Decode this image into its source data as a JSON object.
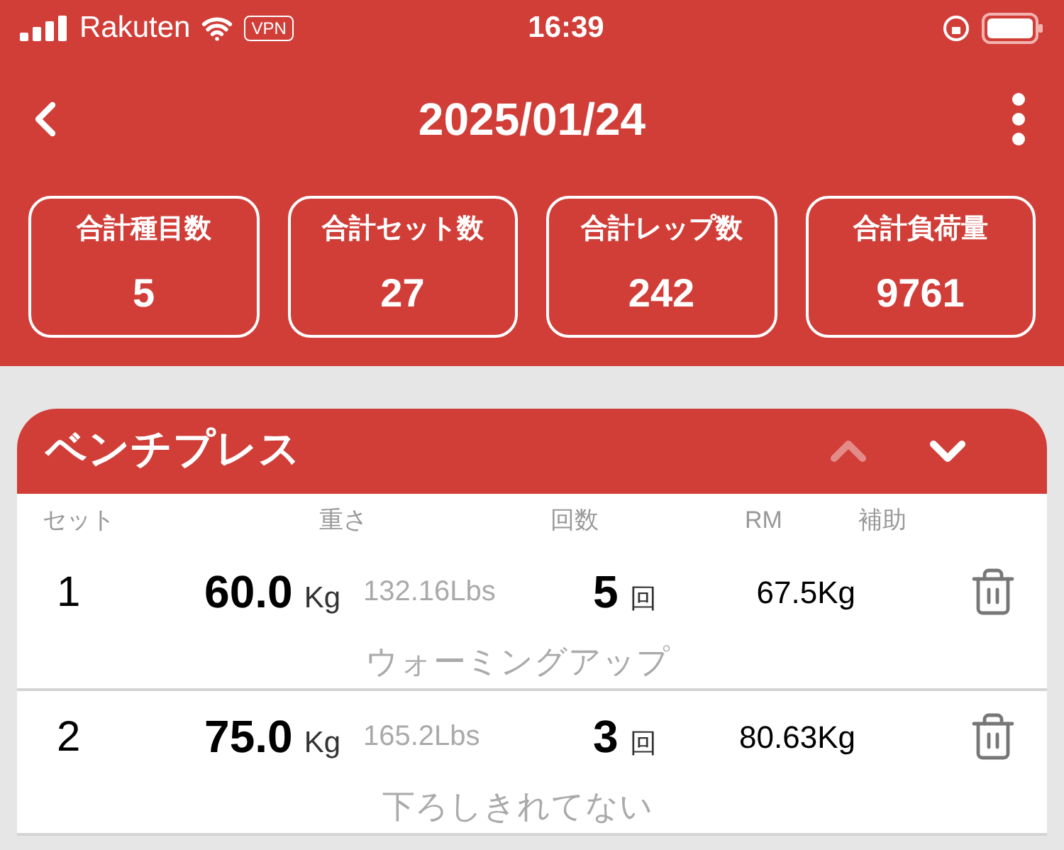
{
  "status_bar": {
    "carrier": "Rakuten",
    "vpn": "VPN",
    "time": "16:39"
  },
  "header": {
    "title": "2025/01/24"
  },
  "stats": [
    {
      "label": "合計種目数",
      "value": "5"
    },
    {
      "label": "合計セット数",
      "value": "27"
    },
    {
      "label": "合計レップ数",
      "value": "242"
    },
    {
      "label": "合計負荷量",
      "value": "9761"
    }
  ],
  "exercise": {
    "name": "ベンチプレス",
    "move_up": {
      "disabled": true
    },
    "move_down": {
      "disabled": false
    },
    "columns": [
      "セット",
      "重さ",
      "回数",
      "RM",
      "補助"
    ],
    "sets": [
      {
        "set": "1",
        "weight": "60.0",
        "weight_unit": "Kg",
        "lbs": "132.16Lbs",
        "reps": "5",
        "reps_unit": "回",
        "rm": "67.5Kg",
        "note": "ウォーミングアップ"
      },
      {
        "set": "2",
        "weight": "75.0",
        "weight_unit": "Kg",
        "lbs": "165.2Lbs",
        "reps": "3",
        "reps_unit": "回",
        "rm": "80.63Kg",
        "note": "下ろしきれてない"
      }
    ]
  }
}
